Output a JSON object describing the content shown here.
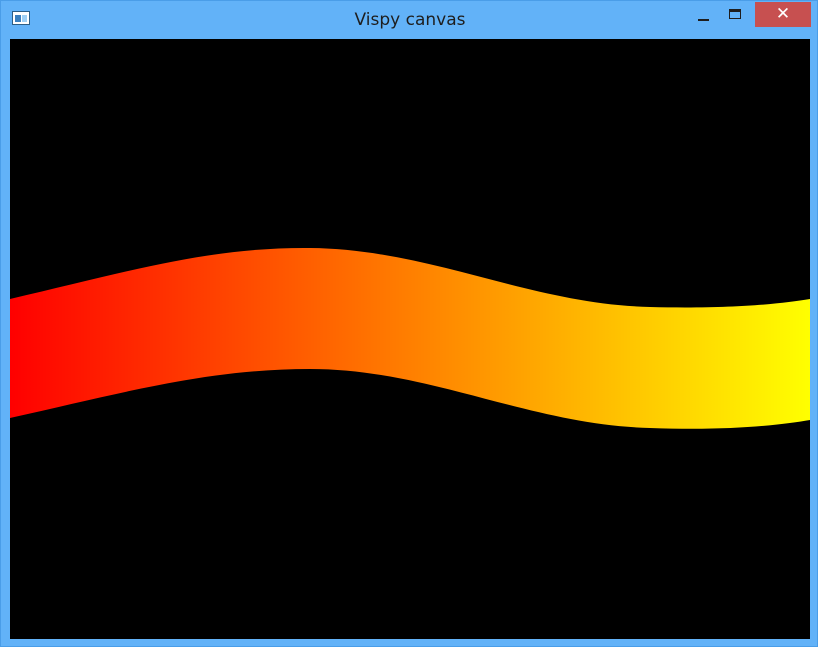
{
  "window": {
    "title": "Vispy canvas",
    "titlebar_color": "#62b2f8",
    "close_button_color": "#c75050"
  },
  "controls": {
    "minimize_icon": "minimize-icon",
    "maximize_icon": "maximize-icon",
    "close_icon": "close-icon",
    "close_glyph": "✕"
  },
  "canvas": {
    "background": "#000000",
    "band_gradient": [
      "#ff0000",
      "#ff7f00",
      "#ffff00"
    ]
  }
}
